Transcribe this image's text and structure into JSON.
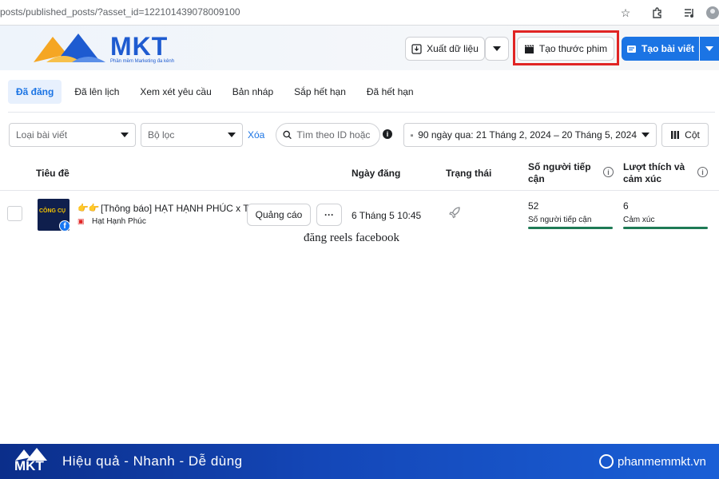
{
  "browser": {
    "url": "posts/published_posts/?asset_id=122101439078009100",
    "icons": [
      "star-icon",
      "extension-icon",
      "media-control-icon",
      "profile-icon"
    ]
  },
  "brand": {
    "logo_text": "MKT",
    "logo_subtitle": "Phần mềm Marketing đa kênh",
    "colors": {
      "primary": "#1e5bd0",
      "accent": "#f5a623"
    }
  },
  "toolbar": {
    "export_label": "Xuất dữ liệu",
    "create_reel_label": "Tạo thước phim",
    "create_post_label": "Tạo bài viết"
  },
  "tabs": [
    {
      "label": "Đã đăng",
      "active": true
    },
    {
      "label": "Đã lên lịch",
      "active": false
    },
    {
      "label": "Xem xét yêu cầu",
      "active": false
    },
    {
      "label": "Bản nháp",
      "active": false
    },
    {
      "label": "Sắp hết hạn",
      "active": false
    },
    {
      "label": "Đã hết hạn",
      "active": false
    }
  ],
  "filters": {
    "post_type_label": "Loại bài viết",
    "filter_label": "Bộ lọc",
    "clear_label": "Xóa",
    "search_placeholder": "Tìm theo ID hoặc c",
    "date_range_label": "90 ngày qua: 21 Tháng 2, 2024 – 20 Tháng 5, 2024",
    "columns_label": "Cột"
  },
  "table": {
    "headers": {
      "title": "Tiêu đề",
      "date": "Ngày đăng",
      "status": "Trạng thái",
      "reach": "Số người tiếp cận",
      "reactions": "Lượt thích và cảm xúc"
    },
    "rows": [
      {
        "thumbnail_text": "CÔNG CỤ",
        "title": "[Thông báo] HẠT HẠNH PHÚC x T...",
        "page_name": "Hạt Hạnh Phúc",
        "boost_label": "Quảng cáo",
        "date": "6 Tháng 5 10:45",
        "reach_value": "52",
        "reach_label": "Số người tiếp cận",
        "reactions_value": "6",
        "reactions_label": "Cảm xúc"
      }
    ]
  },
  "caption": "đăng reels facebook",
  "footer": {
    "logo_text": "MKT",
    "slogan": "Hiệu quả - Nhanh  - Dễ dùng",
    "website": "phanmemmkt.vn"
  }
}
